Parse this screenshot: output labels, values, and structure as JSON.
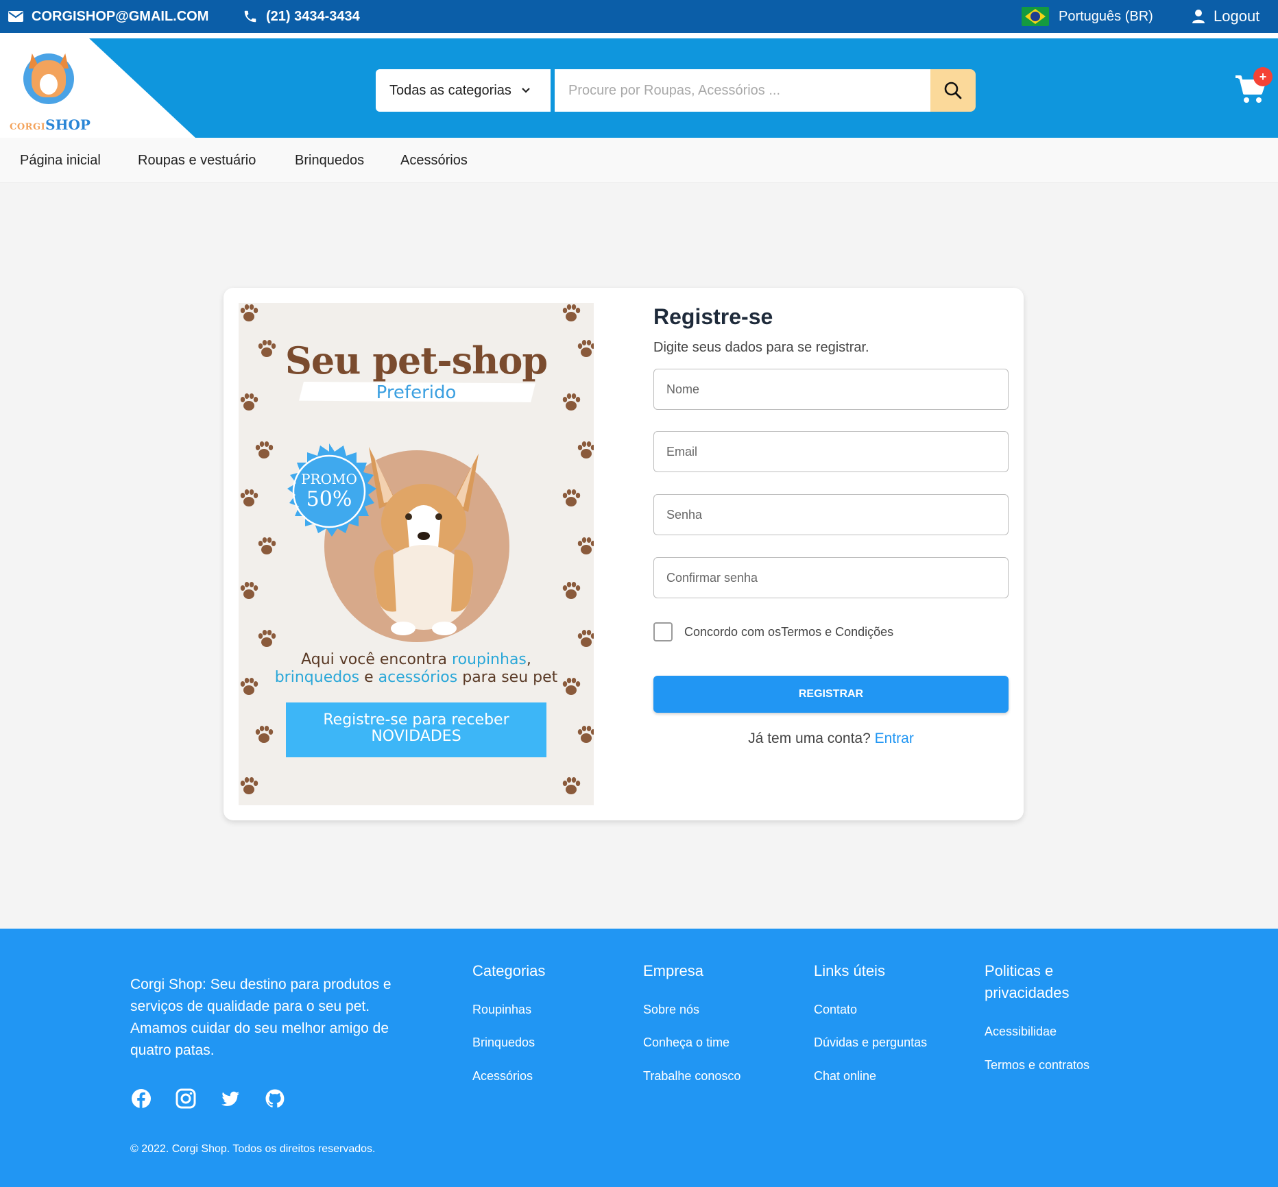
{
  "topbar": {
    "email": "CORGISHOP@GMAIL.COM",
    "phone": "(21) 3434-3434",
    "language": "Português (BR)",
    "logout": "Logout"
  },
  "header": {
    "logo_text_1": "CORGI",
    "logo_text_2": "SHOP",
    "category_select": "Todas as categorias",
    "search_placeholder": "Procure por Roupas, Acessórios ...",
    "cart_badge": "+"
  },
  "nav": {
    "items": [
      "Página inicial",
      "Roupas e vestuário",
      "Brinquedos",
      "Acessórios"
    ]
  },
  "promo": {
    "title": "Seu pet-shop",
    "subtitle": "Preferido",
    "badge_line1": "PROMO",
    "badge_line2": "50%",
    "text_1": "Aqui você encontra ",
    "text_hl_1": "roupinhas",
    "text_2": ",",
    "text_hl_2": "brinquedos",
    "text_3": " e ",
    "text_hl_3": "acessórios",
    "text_4": " para seu pet",
    "cta_line1": "Registre-se para receber",
    "cta_line2": "NOVIDADES"
  },
  "form": {
    "title": "Registre-se",
    "subtitle": "Digite seus dados para se registrar.",
    "name_placeholder": "Nome",
    "email_placeholder": "Email",
    "password_placeholder": "Senha",
    "confirm_placeholder": "Confirmar senha",
    "terms_label": "Concordo com osTermos e Condições",
    "register_button": "REGISTRAR",
    "have_account": "Já tem uma conta? ",
    "login_link": "Entrar"
  },
  "footer": {
    "about": "Corgi Shop: Seu destino para produtos e serviços de qualidade para o seu pet. Amamos cuidar do seu melhor amigo de quatro patas.",
    "columns": [
      {
        "title": "Categorias",
        "links": [
          "Roupinhas",
          "Brinquedos",
          "Acessórios"
        ]
      },
      {
        "title": "Empresa",
        "links": [
          "Sobre nós",
          "Conheça o time",
          "Trabalhe conosco"
        ]
      },
      {
        "title": "Links úteis",
        "links": [
          "Contato",
          "Dúvidas e perguntas",
          "Chat online"
        ]
      },
      {
        "title": "Politicas e privacidades",
        "links": [
          "Acessibilidae",
          "Termos e contratos"
        ]
      }
    ],
    "copyright": "© 2022. Corgi Shop. Todos os direitos reservados."
  },
  "colors": {
    "topbar": "#0b5ea8",
    "header": "#0f96dd",
    "primary": "#2196f3",
    "search_button": "#fbd99a",
    "badge": "#f44336"
  }
}
